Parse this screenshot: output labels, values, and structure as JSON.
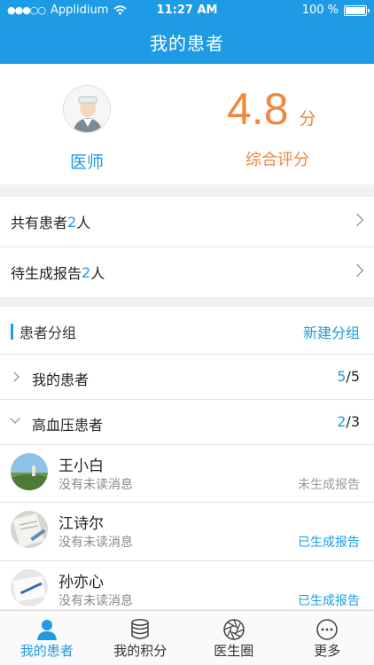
{
  "status_bar": {
    "carrier": "Applidium",
    "time": "11:27 AM",
    "battery": "100 %"
  },
  "nav": {
    "title": "我的患者"
  },
  "profile": {
    "role_label": "医师",
    "score": "4.8",
    "score_unit": "分",
    "score_label": "综合评分"
  },
  "stats": [
    {
      "prefix": "共有患者",
      "count": "2",
      "suffix": "人"
    },
    {
      "prefix": "待生成报告",
      "count": "2",
      "suffix": "人"
    }
  ],
  "groups_section": {
    "title": "患者分组",
    "new_group_label": "新建分组",
    "groups": [
      {
        "name": "我的患者",
        "current": "5",
        "total": "/5",
        "expanded": false
      },
      {
        "name": "高血压患者",
        "current": "2",
        "total": "/3",
        "expanded": true
      }
    ]
  },
  "patients": [
    {
      "name": "王小白",
      "message": "没有未读消息",
      "status": "未生成报告"
    },
    {
      "name": "江诗尔",
      "message": "没有未读消息",
      "status": "已生成报告"
    },
    {
      "name": "孙亦心",
      "message": "没有未读消息",
      "status": "已生成报告"
    }
  ],
  "tabs": [
    {
      "label": "我的患者",
      "icon": "person-icon",
      "active": true
    },
    {
      "label": "我的积分",
      "icon": "database-icon",
      "active": false
    },
    {
      "label": "医生圈",
      "icon": "aperture-icon",
      "active": false
    },
    {
      "label": "更多",
      "icon": "more-icon",
      "active": false
    }
  ],
  "colors": {
    "primary": "#1d9be4",
    "score": "#f0873a",
    "muted": "#888888"
  }
}
